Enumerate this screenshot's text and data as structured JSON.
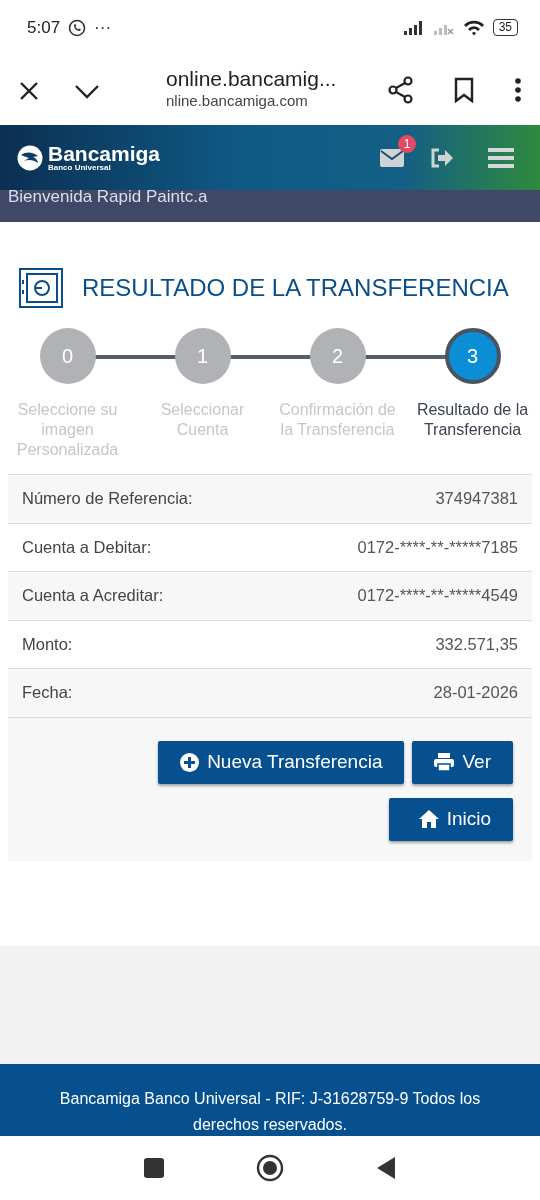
{
  "status_bar": {
    "time": "5:07",
    "more": "···",
    "battery": "35"
  },
  "browser": {
    "title": "online.bancamig...",
    "url": "nline.bancamiga.com"
  },
  "header": {
    "brand": "Bancamiga",
    "tagline": "Banco Universal",
    "unread": "1"
  },
  "welcome": "Bienvenida Rapid Paintc.a",
  "page_title": "RESULTADO DE LA TRANSFERENCIA",
  "steps": [
    {
      "number": "0",
      "label": "Seleccione su imagen Personalizada",
      "selected": false
    },
    {
      "number": "1",
      "label": "Seleccionar Cuenta",
      "selected": false
    },
    {
      "number": "2",
      "label": "Confirmación de la Transferencia",
      "selected": false
    },
    {
      "number": "3",
      "label": "Resultado de la Transferencia",
      "selected": true
    }
  ],
  "details": [
    {
      "label": "Número de Referencia:",
      "value": "374947381"
    },
    {
      "label": "Cuenta a Debitar:",
      "value": "0172-****-**-*****7185"
    },
    {
      "label": "Cuenta a Acreditar:",
      "value": "0172-****-**-*****4549"
    },
    {
      "label": "Monto:",
      "value": "332.571,35"
    },
    {
      "label": "Fecha:",
      "value": "28-01-2026"
    }
  ],
  "buttons": [
    {
      "label": "Nueva Transferencia",
      "kind": "new"
    },
    {
      "label": "Ver",
      "kind": "print"
    },
    {
      "label": "Inicio",
      "kind": "home"
    }
  ],
  "footer": "Bancamiga Banco Universal - RIF: J-31628759-9 Todos los derechos reservados."
}
